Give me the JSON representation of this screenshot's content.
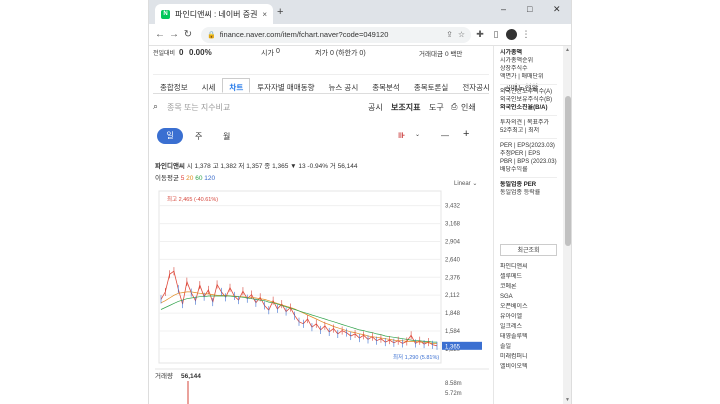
{
  "browser": {
    "tab_title": "파인디앤씨 : 네이버 증권",
    "tab_close": "×",
    "new_tab": "+",
    "url": "finance.naver.com/item/fchart.naver?code=049120",
    "win_min": "–",
    "win_max": "□",
    "win_close": "✕"
  },
  "price_bar": {
    "label": "전일대비",
    "change": "0",
    "rate": "0.00%",
    "open_label": "시가",
    "open_value": "0",
    "low_label": "저가",
    "low_value": "0 (하한가 0)",
    "amount_label": "거래대금",
    "amount_value": "0 백만"
  },
  "subtabs": [
    "종합정보",
    "시세",
    "차트",
    "투자자별 매매동향",
    "뉴스 공시",
    "종목분석",
    "종목토론실",
    "전자공시",
    "공매도현황"
  ],
  "toolbar": {
    "search_placeholder": "종목 또는 지수비교",
    "disclosure": "공시",
    "indicator": "보조지표",
    "tools": "도구",
    "print": "인쇄"
  },
  "periods": {
    "selected": "일",
    "week": "주",
    "month": "월"
  },
  "quote": {
    "name": "파인디앤씨",
    "text": "시 1,378  고 1,382  저 1,357  종 1,365  ▼ 13  -0.94%  거 56,144"
  },
  "moving_avg": {
    "label": "이동평균",
    "values": [
      "5",
      "20",
      "60",
      "120"
    ]
  },
  "scale_mode": "Linear",
  "chart_data": {
    "type": "line",
    "title": "",
    "y_ticks": [
      3432,
      3168,
      2904,
      2640,
      2376,
      2112,
      1848,
      1584,
      1320
    ],
    "ylim": [
      1200,
      3560
    ],
    "last_price": "1,365",
    "high_label": "최고 2,465 (-40.61%)",
    "low_label": "최저 1,290 (5.81%)",
    "volume_label": "거래량",
    "volume_value": "56,144",
    "volume_ticks": [
      "8.58m",
      "5.72m"
    ],
    "series": [
      {
        "name": "종가",
        "values": [
          2050,
          2160,
          2420,
          2465,
          2200,
          1980,
          2310,
          2150,
          2030,
          2260,
          2090,
          2190,
          2010,
          2270,
          2160,
          2080,
          2220,
          2100,
          2040,
          2170,
          2060,
          2120,
          2000,
          2080,
          1960,
          1890,
          2030,
          1910,
          1980,
          1870,
          1930,
          1810,
          1720,
          1690,
          1760,
          1640,
          1690,
          1600,
          1660,
          1570,
          1620,
          1540,
          1590,
          1560,
          1510,
          1540,
          1480,
          1520,
          1460,
          1500,
          1440,
          1470,
          1420,
          1450,
          1410,
          1440,
          1400,
          1430,
          1520,
          1400,
          1440,
          1390,
          1420,
          1380,
          1365
        ]
      },
      {
        "name": "MA20",
        "values": [
          2000,
          2030,
          2070,
          2110,
          2140,
          2150,
          2160,
          2160,
          2150,
          2140,
          2130,
          2130,
          2120,
          2110,
          2110,
          2110,
          2100,
          2100,
          2090,
          2090,
          2080,
          2080,
          2070,
          2060,
          2050,
          2030,
          2010,
          1990,
          1970,
          1950,
          1930,
          1910,
          1880,
          1850,
          1820,
          1790,
          1760,
          1730,
          1700,
          1680,
          1650,
          1630,
          1610,
          1590,
          1570,
          1560,
          1540,
          1530,
          1510,
          1500,
          1490,
          1480,
          1470,
          1460,
          1450,
          1440,
          1440,
          1430,
          1430,
          1430,
          1420,
          1420,
          1410,
          1400,
          1400
        ]
      },
      {
        "name": "MA60",
        "values": [
          1900,
          1930,
          1960,
          1990,
          2020,
          2040,
          2060,
          2070,
          2080,
          2090,
          2090,
          2100,
          2100,
          2100,
          2100,
          2100,
          2100,
          2090,
          2090,
          2080,
          2070,
          2060,
          2050,
          2040,
          2030,
          2010,
          2000,
          1980,
          1960,
          1940,
          1920,
          1900,
          1880,
          1860,
          1840,
          1820,
          1800,
          1780,
          1760,
          1740,
          1720,
          1700,
          1680,
          1660,
          1640,
          1620,
          1600,
          1590,
          1570,
          1560,
          1540,
          1530,
          1510,
          1500,
          1490,
          1480,
          1470,
          1460,
          1450,
          1440,
          1440,
          1430,
          1430,
          1420,
          1420
        ]
      }
    ]
  },
  "sidebar": {
    "market_cap": "시가총액",
    "market_cap_rank": "시가총액순위",
    "listed_shares": "상장주식수",
    "par_unit": "액면가 | 매매단위",
    "foreign_limit": "외국인한도주식수(A)",
    "foreign_hold": "외국인보유주식수(B)",
    "foreign_rate": "외국인소진율(B/A)",
    "opinion": "투자의견 | 목표주가",
    "range52": "52주최고 | 최저",
    "per": "PER | EPS(2023.03)",
    "est_per": "추정PER | EPS",
    "pbr": "PBR | BPS (2023.03)",
    "dividend": "배당수익률",
    "sector_per": "동일업종 PER",
    "sector_rate": "동일업종 등락률",
    "recent_btn": "최근조회",
    "recent": [
      "파인디앤씨",
      "셀루메드",
      "코메론",
      "SGA",
      "오픈베이스",
      "유아이엘",
      "일크레스",
      "태영솔루텍",
      "솔일",
      "미래컴퍼니",
      "엘비이오텍"
    ]
  }
}
